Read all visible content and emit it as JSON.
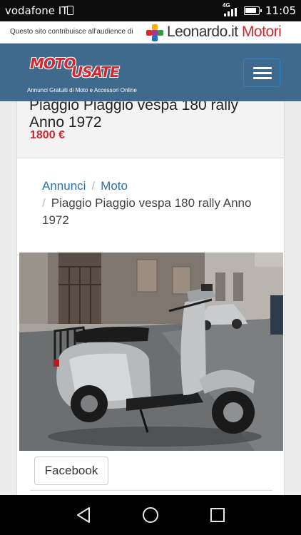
{
  "status_bar": {
    "carrier": "vodafone IT",
    "network": "4G",
    "time": "11:05"
  },
  "leonardo_bar": {
    "notice": "Questo sito contribuisce all'audience di",
    "brand": "Leonardo.it",
    "brand_suffix": "Motori"
  },
  "header": {
    "logo_word1": "MOTO",
    "logo_word2": "USATE",
    "logo_tagline": "Annunci Gratuiti di Moto e Accessori Online",
    "menu_icon": "hamburger-menu-icon"
  },
  "listing": {
    "title": "Piaggio Piaggio vespa 180 rally Anno 1972",
    "price": "1800 €"
  },
  "breadcrumb": {
    "item1": "Annunci",
    "item2": "Moto",
    "current": "Piaggio Piaggio vespa 180 rally Anno 1972"
  },
  "actions": {
    "facebook_label": "Facebook"
  },
  "nav_bar": {
    "back_icon": "back-triangle-icon",
    "home_icon": "home-circle-icon",
    "recents_icon": "recents-square-icon"
  },
  "colors": {
    "header_bg": "#3f6a8d",
    "price": "#d0262c",
    "link": "#2a73b3",
    "brand_accent": "#d6262e"
  }
}
